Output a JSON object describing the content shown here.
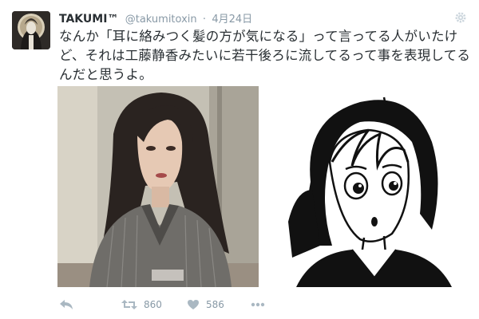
{
  "tweet": {
    "display_name": "TAKUMI™",
    "handle": "@takumitoxin",
    "separator": "·",
    "date": "4月24日",
    "text": "なんか「耳に絡みつく髪の方が気になる」って言ってる人がいたけど、それは工藤静香みたいに若干後ろに流してるって事を表現してるんだと思うよ。",
    "media": [
      {
        "subject": "photo-woman-long-hair"
      },
      {
        "subject": "manga-drawing-girl"
      }
    ],
    "actions": {
      "reply_icon": "reply-icon",
      "retweet_icon": "retweet-icon",
      "retweet_count": "860",
      "like_icon": "heart-icon",
      "like_count": "586",
      "more_icon": "more-dots-icon"
    },
    "colors": {
      "name": "#292f33",
      "meta": "#8899a6",
      "action": "#aab8c2"
    }
  }
}
